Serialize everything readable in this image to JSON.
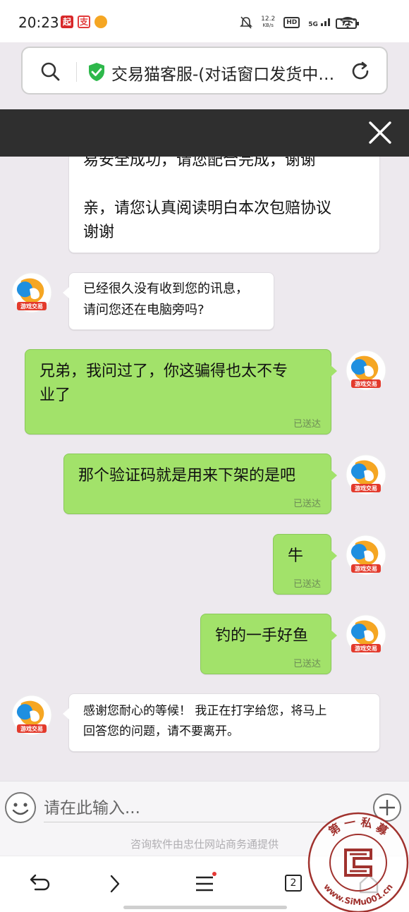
{
  "status_bar": {
    "time": "20:23",
    "net_speed_value": "12.2",
    "net_speed_unit": "KB/s",
    "hd_label": "HD",
    "network_label": "5G",
    "battery": "71"
  },
  "browser": {
    "page_title": "交易猫客服-(对话窗口发货中…"
  },
  "messages": [
    {
      "side": "agent",
      "lines": [
        "易安全成功，请您配合完成，谢谢",
        "亲，请您认真阅读明白本次包赔协议",
        "谢谢"
      ]
    },
    {
      "side": "agent",
      "lines": [
        "已经很久没有收到您的讯息，",
        "请问您还在电脑旁吗?"
      ]
    },
    {
      "side": "user",
      "lines": [
        "兄弟，我问过了，你这骗得也太不专",
        "业了"
      ],
      "status": "已送达"
    },
    {
      "side": "user",
      "lines": [
        "那个验证码就是用来下架的是吧"
      ],
      "status": "已送达"
    },
    {
      "side": "user",
      "lines": [
        "牛"
      ],
      "status": "已送达"
    },
    {
      "side": "user",
      "lines": [
        "钓的一手好鱼"
      ],
      "status": "已送达"
    },
    {
      "side": "agent",
      "lines": [
        "感谢您耐心的等候！ 我正在打字给您，将马上",
        "回答您的问题，请不要离开。"
      ]
    }
  ],
  "avatar_label": "游戏交易",
  "input": {
    "placeholder": "请在此输入...",
    "provider_text": "咨询软件由忠仕网站商务通提供"
  },
  "nav": {
    "tab_count": "2"
  },
  "watermark": {
    "top_text": "第 一 私 募",
    "bottom_text": "www.SiMu001.cn"
  },
  "colors": {
    "user_bubble": "#a2e26a",
    "agent_bubble": "#ffffff",
    "chat_background": "#ede9ee",
    "header_dark": "#2f2f2f",
    "secure_shield": "#2eb84b",
    "watermark_red": "#a0322e"
  }
}
